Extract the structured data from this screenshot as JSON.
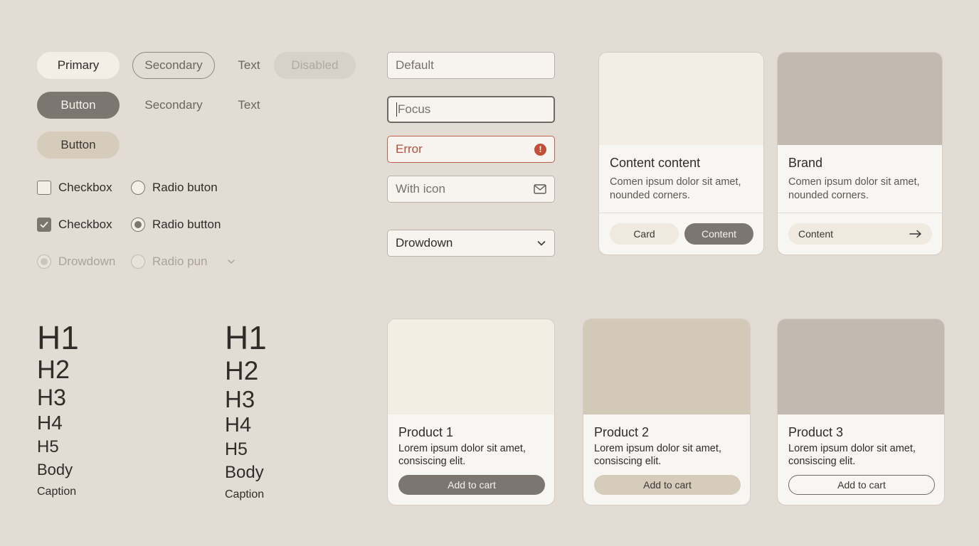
{
  "buttons": {
    "row1": {
      "primary": "Primary",
      "secondary": "Secondary",
      "text": "Text",
      "disabled": "Disabled"
    },
    "row2": {
      "button": "Button",
      "secondary": "Secondary",
      "text": "Text"
    },
    "row3": {
      "button": "Button"
    }
  },
  "controls": {
    "checkbox_unchecked": "Checkbox",
    "radio_unchecked": "Radio buton",
    "checkbox_checked": "Checkbox",
    "radio_checked": "Radio button",
    "disabled_dropdown": "Drowdown",
    "disabled_radio": "Radio pun"
  },
  "fields": {
    "default_placeholder": "Default",
    "focus_placeholder": "Focus",
    "error_value": "Error",
    "icon_placeholder": "With icon",
    "dropdown_value": "Drowdown"
  },
  "cards": {
    "content": {
      "title": "Content content",
      "desc_line1": "Comen ipsum dolor sit amet,",
      "desc_line2": "nounded corners.",
      "button_light": "Card",
      "button_dark": "Content"
    },
    "brand": {
      "title": "Brand",
      "desc_line1": "Comen ipsum dolor sit amet,",
      "desc_line2": "nounded corners.",
      "button": "Content"
    }
  },
  "typography": {
    "col1": {
      "h1": "H1",
      "h2": "H2",
      "h3": "H3",
      "h4": "H4",
      "h5": "H5",
      "body": "Body",
      "caption": "Caption"
    },
    "col2": {
      "h1": "H1",
      "h2": "H2",
      "h3": "H3",
      "h4": "H4",
      "h5": "H5",
      "body": "Body",
      "caption": "Caption"
    }
  },
  "products": [
    {
      "title": "Product 1",
      "desc_line1": "Lorem ipsum dolor sit amet,",
      "desc_line2": "consiscing elit.",
      "button": "Add to cart"
    },
    {
      "title": "Product 2",
      "desc_line1": "Lorem ipsum dolor sit amet,",
      "desc_line2": "consiscing elit.",
      "button": "Add to cart"
    },
    {
      "title": "Product 3",
      "desc_line1": "Lorem ipsum dolor sit amet,",
      "desc_line2": "consiscing elit.",
      "button": "Add to cart"
    }
  ],
  "colors": {
    "background": "#e3dcd5",
    "dark": "#7b766f",
    "beige": "#d6ccbc",
    "cream": "#f3eee6",
    "error": "#c0503a"
  }
}
